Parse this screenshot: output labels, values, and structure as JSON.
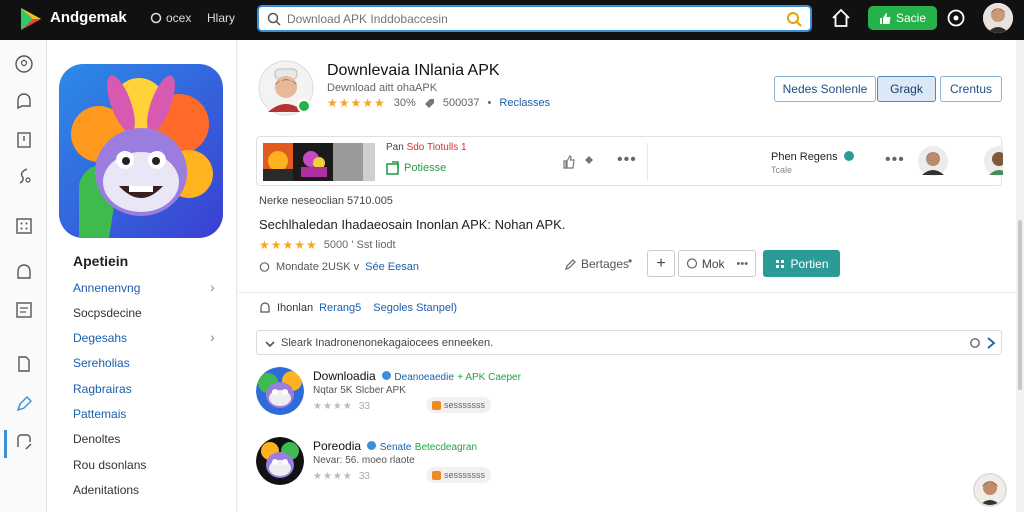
{
  "topbar": {
    "brand": "Andgemak",
    "link1": "ocex",
    "link2": "Hlary",
    "search_placeholder": "Download APK Inddobaccesin",
    "signin_label": "Sacie"
  },
  "sidebar": {
    "title": "Apetiein",
    "items": [
      {
        "label": "Annenenvng",
        "style": "blue"
      },
      {
        "label": "Socpsdecine",
        "style": "dark"
      },
      {
        "label": "Degesahs",
        "style": "blue"
      },
      {
        "label": "Sereholias",
        "style": "blue"
      },
      {
        "label": "Ragbrairas",
        "style": "blue"
      },
      {
        "label": "Pattemais",
        "style": "blue"
      },
      {
        "label": "Denoltes",
        "style": "dark"
      },
      {
        "label": "Rou dsonlans",
        "style": "dark"
      },
      {
        "label": "Adenitations",
        "style": "dark"
      }
    ]
  },
  "app": {
    "title": "Downlevaia INlania APK",
    "subtitle": "Dewnload aitt ohaAPK",
    "rating_stars": "★★★★★",
    "rating_value": "30%",
    "downloads": "500037",
    "releases": "Reclasses"
  },
  "tabs": [
    "Nedes Sonlenle",
    "Gragk",
    "Crentus"
  ],
  "promo": {
    "title_prefix": "Pan ",
    "title_red": "Sdo Tiotulls 1",
    "download_label": "Potiesse",
    "user_name": "Phen Regens",
    "user_sub": "Tcale"
  },
  "meta": {
    "line1": "Nerke neseoclian  5710.005",
    "description": "Sechlhaledan Ihadaeosain Inonlan APK: Nohan APK.",
    "rating_stars": "★★★★★",
    "rating_text": "5000 ' Sst liodt",
    "size_label": "Mondate 2USK v",
    "see_season": "Sée Eesan",
    "settings_label": "Bertages",
    "mok_label": "Mok",
    "perform_label": "Portien"
  },
  "tags": {
    "label": "Ihonlan",
    "link1": "Rerang5",
    "link2": "Segoles Stanpel)"
  },
  "filter_text": "Sleark Inadronenonekagaiocees enneeken.",
  "list": [
    {
      "title": "Downloadia",
      "badge_blue": "Deanoeaedie",
      "badge_green": "+ APK Caeper",
      "sub": "Nqtar  5K Slcber APK",
      "rating": "33",
      "tag": "sesssssss"
    },
    {
      "title": "Poreodia",
      "badge_blue": "Senate",
      "badge_green": "Betecdeagran",
      "sub": "Nevar: 56. moeo rlaote",
      "rating": "33",
      "tag": "sesssssss"
    }
  ],
  "colors": {
    "accent_blue": "#1b5fae",
    "green": "#25b24a",
    "teal": "#2b9b98",
    "star": "#f5a623"
  }
}
